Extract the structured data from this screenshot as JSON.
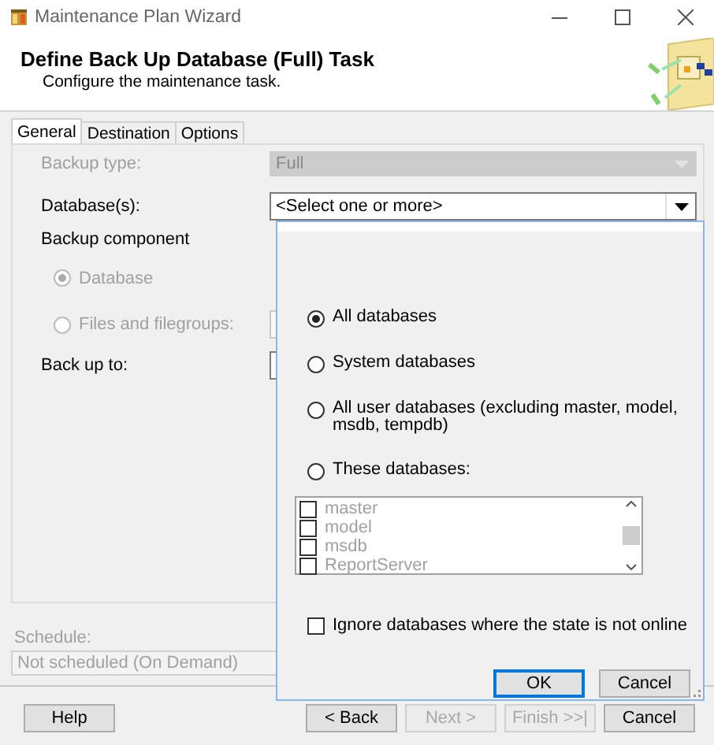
{
  "window": {
    "title": "Maintenance Plan Wizard"
  },
  "header": {
    "title": "Define Back Up Database (Full) Task",
    "subtitle": "Configure the maintenance task."
  },
  "tabs": [
    {
      "label": "General",
      "selected": true
    },
    {
      "label": "Destination",
      "selected": false
    },
    {
      "label": "Options",
      "selected": false
    }
  ],
  "form": {
    "backup_type": {
      "label": "Backup type:",
      "value": "Full",
      "disabled": true
    },
    "databases": {
      "label": "Database(s):",
      "value": "<Select one or more>"
    },
    "backup_component": {
      "label": "Backup component",
      "options": [
        {
          "label": "Database",
          "selected": true,
          "disabled": true
        },
        {
          "label": "Files and filegroups:",
          "selected": false,
          "disabled": true
        }
      ]
    },
    "back_up_to": {
      "label": "Back up to:"
    },
    "schedule": {
      "label": "Schedule:",
      "value": "Not scheduled (On Demand)",
      "disabled": true
    }
  },
  "popup": {
    "options": [
      {
        "label": "All databases",
        "selected": true
      },
      {
        "label": "System databases",
        "selected": false
      },
      {
        "label": "All user databases  (excluding master, model, msdb, tempdb)",
        "selected": false
      },
      {
        "label": "These databases:",
        "selected": false
      }
    ],
    "list": {
      "disabled": true,
      "items": [
        {
          "label": "master",
          "checked": false
        },
        {
          "label": "model",
          "checked": false
        },
        {
          "label": "msdb",
          "checked": false
        },
        {
          "label": "ReportServer",
          "checked": false
        }
      ]
    },
    "ignore_offline": {
      "label": "Ignore databases where the state is not online",
      "checked": false
    },
    "buttons": [
      {
        "label": "OK",
        "focused": true
      },
      {
        "label": "Cancel",
        "focused": false
      }
    ]
  },
  "buttons": [
    {
      "label": "Help",
      "disabled": false
    },
    {
      "label": "< Back",
      "disabled": false
    },
    {
      "label": "Next >",
      "disabled": true
    },
    {
      "label": "Finish >>|",
      "disabled": true
    },
    {
      "label": "Cancel",
      "disabled": false
    }
  ]
}
